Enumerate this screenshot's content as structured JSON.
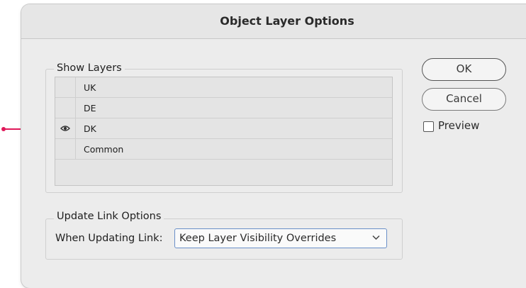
{
  "dialog": {
    "title": "Object Layer Options"
  },
  "show_layers": {
    "label": "Show Layers",
    "layers": [
      {
        "name": "UK",
        "visible": false
      },
      {
        "name": "DE",
        "visible": false
      },
      {
        "name": "DK",
        "visible": true
      },
      {
        "name": "Common",
        "visible": false
      }
    ]
  },
  "buttons": {
    "ok_label": "OK",
    "cancel_label": "Cancel"
  },
  "preview": {
    "label": "Preview",
    "checked": false
  },
  "update_link": {
    "group_label": "Update Link Options",
    "field_label": "When Updating Link:",
    "selected_option": "Keep Layer Visibility Overrides"
  },
  "icons": {
    "eye": "eye-icon",
    "chevron": "chevron-down-icon",
    "annotation": "annotation-arrow-icon"
  },
  "colors": {
    "annotation_arrow": "#e0195a",
    "select_focus": "#6a8fc8"
  }
}
